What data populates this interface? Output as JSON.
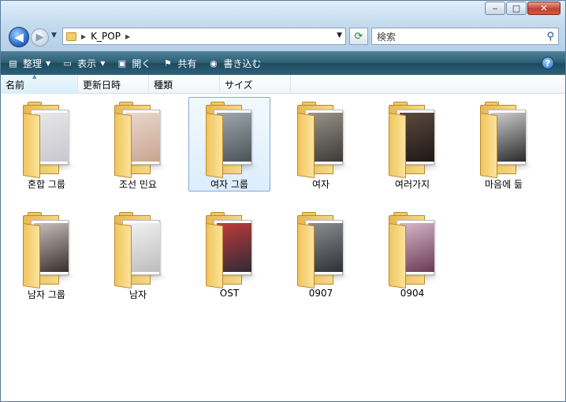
{
  "address": {
    "crumb": "K_POP"
  },
  "search": {
    "placeholder": "検索"
  },
  "commands": [
    {
      "label": "整理",
      "icon": "organize-icon",
      "dropdown": true
    },
    {
      "label": "表示",
      "icon": "views-icon",
      "dropdown": true
    },
    {
      "label": "開く",
      "icon": "open-icon",
      "dropdown": false
    },
    {
      "label": "共有",
      "icon": "share-icon",
      "dropdown": false
    },
    {
      "label": "書き込む",
      "icon": "burn-icon",
      "dropdown": false
    }
  ],
  "columns": [
    "名前",
    "更新日時",
    "種類",
    "サイズ"
  ],
  "folders": [
    {
      "name": "혼합 그룹",
      "photo": [
        "#e8e8e8",
        "#c8c8d0"
      ]
    },
    {
      "name": "조선 민요",
      "photo": [
        "#e9d9cf",
        "#c9a48f"
      ]
    },
    {
      "name": "여자 그룹",
      "photo": [
        "#9fa8ad",
        "#4c5357"
      ],
      "selected": true
    },
    {
      "name": "여자",
      "photo": [
        "#9a958b",
        "#3b3a37"
      ]
    },
    {
      "name": "여러가지",
      "photo": [
        "#5d4a3e",
        "#1e1816"
      ]
    },
    {
      "name": "마음에 듦",
      "photo": [
        "#cfcfcf",
        "#2a2a2a"
      ]
    },
    {
      "name": "남자 그룹",
      "photo": [
        "#c8c0bc",
        "#3a2f2f"
      ]
    },
    {
      "name": "남자",
      "photo": [
        "#f2f2f2",
        "#bdbdbd"
      ]
    },
    {
      "name": "OST",
      "photo": [
        "#c23b3b",
        "#2e2b35"
      ]
    },
    {
      "name": "0907",
      "photo": [
        "#8d8f92",
        "#2d3034"
      ]
    },
    {
      "name": "0904",
      "photo": [
        "#d7b8c8",
        "#6b3a55"
      ]
    }
  ]
}
